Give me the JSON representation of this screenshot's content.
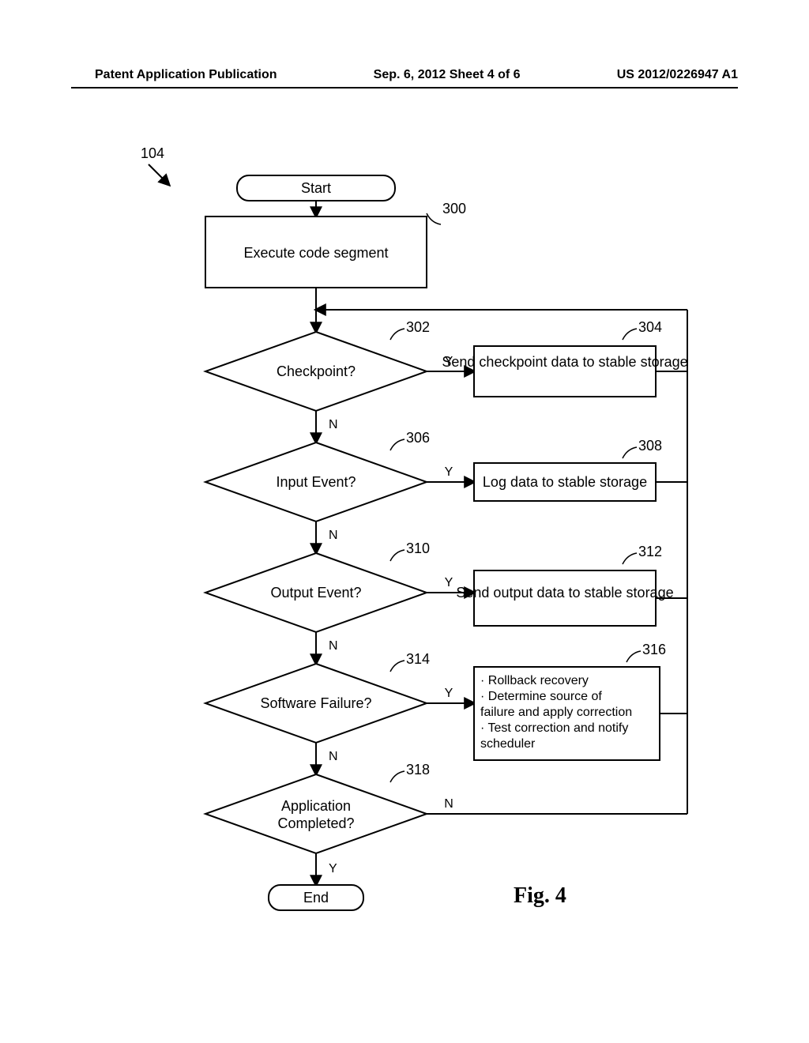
{
  "header": {
    "left": "Patent Application Publication",
    "center": "Sep. 6, 2012   Sheet 4 of 6",
    "right": "US 2012/0226947 A1"
  },
  "fig_ref": "104",
  "terminator": {
    "start": "Start",
    "end": "End"
  },
  "process": {
    "p300": "Execute code segment",
    "p304": "Send checkpoint data to stable storage",
    "p308": "Log data to stable storage",
    "p312": "Send output data to stable storage",
    "p316_l1": "· Rollback recovery",
    "p316_l2": "· Determine source of",
    "p316_l3": "failure and apply correction",
    "p316_l4": "· Test correction and notify",
    "p316_l5": "scheduler"
  },
  "decision": {
    "d302": "Checkpoint?",
    "d306": "Input Event?",
    "d310": "Output Event?",
    "d314": "Software Failure?",
    "d318_l1": "Application",
    "d318_l2": "Completed?"
  },
  "edge": {
    "yes": "Y",
    "no": "N"
  },
  "ref": {
    "r300": "300",
    "r302": "302",
    "r304": "304",
    "r306": "306",
    "r308": "308",
    "r310": "310",
    "r312": "312",
    "r314": "314",
    "r316": "316",
    "r318": "318"
  },
  "figure_caption": "Fig. 4"
}
